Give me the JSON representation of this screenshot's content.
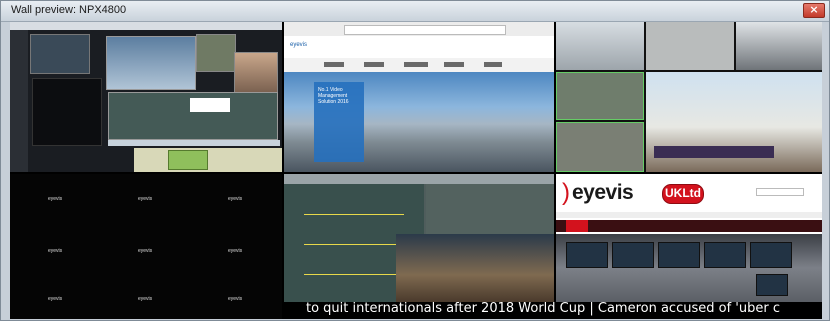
{
  "window": {
    "title": "Wall preview: NPX4800",
    "close_label": "×"
  },
  "wall": {
    "web_tile": {
      "logo_text": "eyevis",
      "hero_title": "No.1 Video Management Solution 2016"
    },
    "eyevis_labels": [
      "eyevis",
      "eyevis",
      "eyevis",
      "eyevis",
      "eyevis",
      "eyevis",
      "eyevis",
      "eyevis",
      "eyevis"
    ],
    "brand_tile": {
      "brand": "eyevis",
      "badge": "UKLtd"
    },
    "ticker_text": "to quit internationals after 2018 World Cup   |   Cameron accused of 'uber c"
  },
  "colors": {
    "eyevis_red": "#d3121d",
    "titlebar_close": "#c23a2a",
    "wall_background": "#000000"
  },
  "icons": [
    "close-icon"
  ]
}
